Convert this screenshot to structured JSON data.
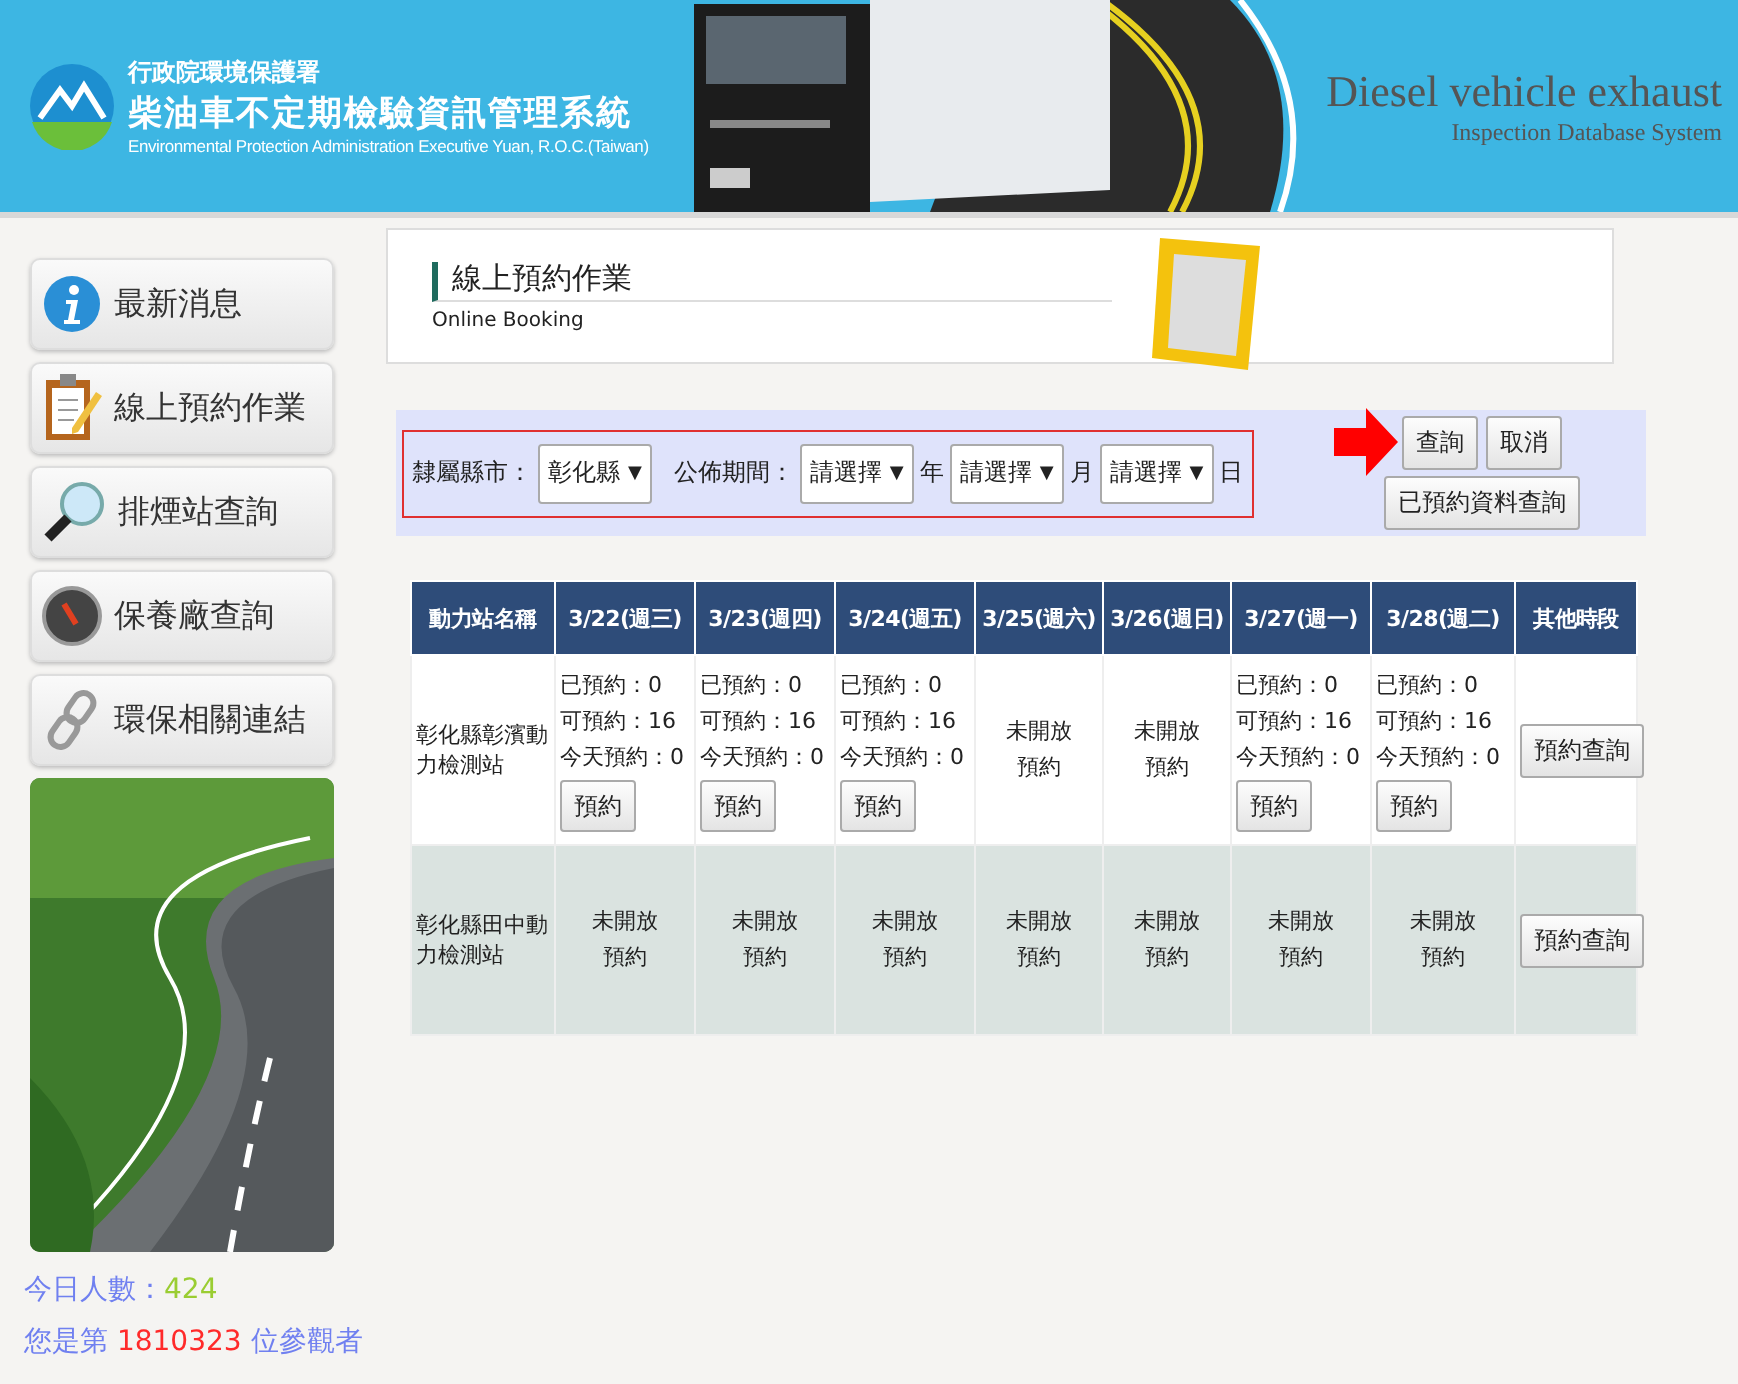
{
  "header": {
    "agency": "行政院環境保護署",
    "system_title": "柴油車不定期檢驗資訊管理系統",
    "english_agency": "Environmental Protection Administration Executive Yuan, R.O.C.(Taiwan)",
    "english_title": "Diesel vehicle exhaust",
    "english_subtitle": "Inspection Database System"
  },
  "sidebar": {
    "items": [
      {
        "label": "最新消息",
        "kind": "info"
      },
      {
        "label": "線上預約作業",
        "kind": "clipboard"
      },
      {
        "label": "排煙站查詢",
        "kind": "magnifier"
      },
      {
        "label": "保養廠查詢",
        "kind": "gauge"
      },
      {
        "label": "環保相關連結",
        "kind": "link"
      }
    ],
    "visitors_today_label": "今日人數：",
    "visitors_today": "424",
    "visitor_prefix": "您是第",
    "visitor_number": "1810323",
    "visitor_suffix": "位參觀者"
  },
  "page_title": {
    "title": "線上預約作業",
    "subtitle": "Online Booking"
  },
  "filter": {
    "county_label": "隸屬縣市：",
    "county": "彰化縣",
    "county_caret": "▼",
    "period_label": "公佈期間：",
    "period_selects": [
      {
        "value": "請選擇",
        "caret": "▼",
        "unit": "年"
      },
      {
        "value": "請選擇",
        "caret": "▼",
        "unit": "月"
      },
      {
        "value": "請選擇",
        "caret": "▼",
        "unit": "日"
      }
    ],
    "buttons": [
      "查詢",
      "取消"
    ],
    "booked_query_button": "已預約資料查詢"
  },
  "table": {
    "columns": [
      "動力站名稱",
      "3/22(週三)",
      "3/23(週四)",
      "3/24(週五)",
      "3/25(週六)",
      "3/26(週日)",
      "3/27(週一)",
      "3/28(週二)",
      "其他時段"
    ],
    "rows": [
      {
        "cells": [
          {
            "kind": "station",
            "lines": [
              "彰化縣彰濱動力檢測站"
            ]
          },
          {
            "kind": "open",
            "lines": [
              "已預約：0",
              "可預約：16",
              "今天預約：0"
            ],
            "button": "預約"
          },
          {
            "kind": "open",
            "lines": [
              "已預約：0",
              "可預約：16",
              "今天預約：0"
            ],
            "button": "預約"
          },
          {
            "kind": "open",
            "lines": [
              "已預約：0",
              "可預約：16",
              "今天預約：0"
            ],
            "button": "預約"
          },
          {
            "kind": "closed",
            "lines": [
              "未開放",
              "預約"
            ]
          },
          {
            "kind": "closed",
            "lines": [
              "未開放",
              "預約"
            ]
          },
          {
            "kind": "open",
            "lines": [
              "已預約：0",
              "可預約：16",
              "今天預約：0"
            ],
            "button": "預約"
          },
          {
            "kind": "open",
            "lines": [
              "已預約：0",
              "可預約：16",
              "今天預約：0"
            ],
            "button": "預約"
          },
          {
            "kind": "action",
            "button": "預約查詢"
          }
        ]
      },
      {
        "cells": [
          {
            "kind": "station",
            "lines": [
              "彰化縣田中動力檢測站"
            ]
          },
          {
            "kind": "closed",
            "lines": [
              "未開放",
              "預約"
            ]
          },
          {
            "kind": "closed",
            "lines": [
              "未開放",
              "預約"
            ]
          },
          {
            "kind": "closed",
            "lines": [
              "未開放",
              "預約"
            ]
          },
          {
            "kind": "closed",
            "lines": [
              "未開放",
              "預約"
            ]
          },
          {
            "kind": "closed",
            "lines": [
              "未開放",
              "預約"
            ]
          },
          {
            "kind": "closed",
            "lines": [
              "未開放",
              "預約"
            ]
          },
          {
            "kind": "closed",
            "lines": [
              "未開放",
              "預約"
            ]
          },
          {
            "kind": "action",
            "button": "預約查詢"
          }
        ]
      }
    ]
  }
}
